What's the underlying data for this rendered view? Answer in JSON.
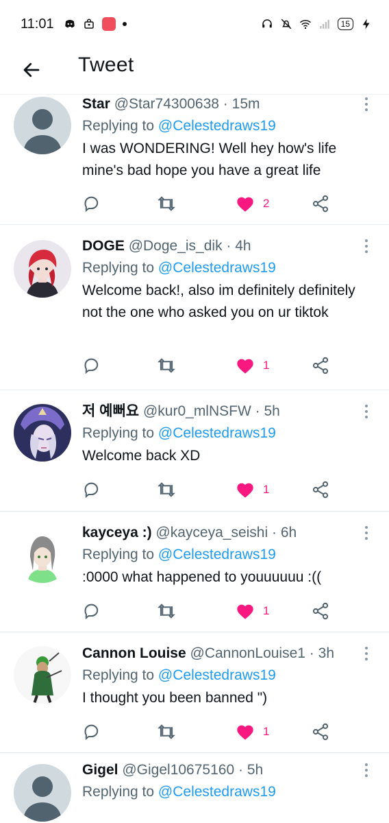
{
  "status_bar": {
    "time": "11:01",
    "battery": "15",
    "icons_left": [
      "discord-icon",
      "bag-icon",
      "app-icon",
      "dot-icon"
    ],
    "icons_right": [
      "headset-icon",
      "mute-icon",
      "wifi-icon",
      "signal-icon",
      "battery-icon",
      "charging-icon"
    ]
  },
  "header": {
    "title": "Tweet",
    "back_icon": "arrow-left-icon"
  },
  "tweets": [
    {
      "name": "Star",
      "handle": "@Star74300638",
      "sep": " · ",
      "time": "15m",
      "replying_label": "Replying to ",
      "replying_to": "@Celestedraws19",
      "text": "I was WONDERING! Well hey how's life mine's bad hope you have a great life",
      "likes": "2",
      "avatar": "default-avatar"
    },
    {
      "name": "DOGE",
      "handle": "@Doge_is_dik",
      "sep": " · ",
      "time": "4h",
      "replying_label": "Replying to ",
      "replying_to": "@Celestedraws19",
      "text": "Welcome back!, also im definitely definitely not the one who asked you on ur tiktok",
      "likes": "1",
      "avatar": "red-hair-anime-avatar"
    },
    {
      "name": "저 예뻐요",
      "handle": "@kur0_mlNSFW",
      "sep": " · ",
      "time": "5h",
      "replying_label": "Replying to ",
      "replying_to": "@Celestedraws19",
      "text": "Welcome back XD",
      "likes": "1",
      "avatar": "purple-anime-avatar"
    },
    {
      "name": "kayceya :)",
      "handle": "@kayceya_seishi",
      "sep": " · ",
      "time": "6h",
      "replying_label": "Replying to ",
      "replying_to": "@Celestedraws19",
      "text": ":0000 what happened to youuuuuu :((",
      "likes": "1",
      "avatar": "gray-hair-anime-avatar"
    },
    {
      "name": "Cannon Louise",
      "handle": "@CannonLouise1",
      "sep": " · ",
      "time": "3h",
      "replying_label": "Replying to ",
      "replying_to": "@Celestedraws19",
      "text": "I thought you been banned \")",
      "likes": "1",
      "avatar": "swordsman-avatar"
    },
    {
      "name": "Gigel",
      "handle": "@Gigel10675160",
      "sep": " · ",
      "time": "5h",
      "replying_label": "Replying to ",
      "replying_to": "@Celestedraws19",
      "text": "",
      "likes": "",
      "avatar": "default-avatar"
    }
  ],
  "colors": {
    "like": "#f91880",
    "link": "#1d9bf0",
    "secondary": "#536471"
  }
}
